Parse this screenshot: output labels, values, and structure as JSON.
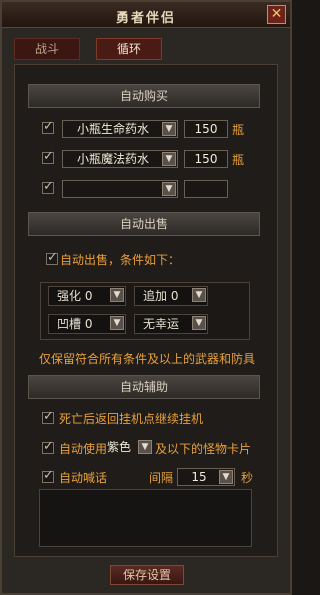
{
  "window": {
    "title": "勇者伴侣"
  },
  "tabs": [
    {
      "label": "战斗"
    },
    {
      "label": "循环"
    }
  ],
  "auto_buy": {
    "header": "自动购买",
    "rows": [
      {
        "item": "小瓶生命药水",
        "qty": "150",
        "unit": "瓶",
        "checked": true
      },
      {
        "item": "小瓶魔法药水",
        "qty": "150",
        "unit": "瓶",
        "checked": true
      },
      {
        "item": "",
        "qty": "",
        "unit": "",
        "checked": true
      }
    ]
  },
  "auto_sell": {
    "header": "自动出售",
    "enable_label": "自动出售，条件如下：",
    "conditions": [
      {
        "label": "强化",
        "value": "0"
      },
      {
        "label": "追加",
        "value": "0"
      },
      {
        "label": "凹槽",
        "value": "0"
      },
      {
        "label": "无幸运",
        "value": ""
      }
    ],
    "note": "仅保留符合所有条件及以上的武器和防具"
  },
  "auto_assist": {
    "header": "自动辅助",
    "respawn_label": "死亡后返回挂机点继续挂机",
    "use_prefix": "自动使用",
    "use_color": "紫色",
    "use_suffix": "及以下的怪物卡片",
    "shout_label": "自动喊话",
    "interval_label": "间隔",
    "interval_value": "15",
    "interval_unit": "秒"
  },
  "footer": {
    "save_label": "保存设置"
  },
  "colors": {
    "accent": "#e9a03b",
    "tab_active": "#4a1a14",
    "close": "#6d2418"
  }
}
